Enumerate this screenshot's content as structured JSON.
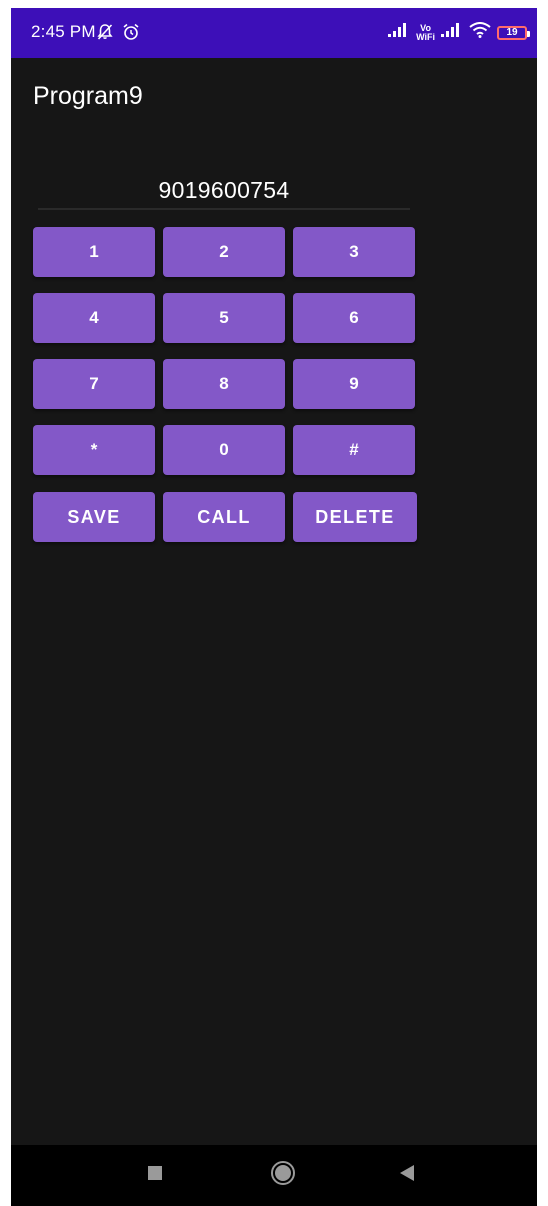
{
  "status_bar": {
    "time": "2:45 PM",
    "volte_top": "Vo",
    "volte_bottom": "WiFi",
    "battery": "19",
    "icons": [
      "bell-off-icon",
      "alarm-icon",
      "signal-icon",
      "signal-icon",
      "wifi-icon",
      "battery-icon"
    ]
  },
  "app": {
    "title": "Program9"
  },
  "dialer": {
    "number": "9019600754",
    "keys": {
      "k1": "1",
      "k2": "2",
      "k3": "3",
      "k4": "4",
      "k5": "5",
      "k6": "6",
      "k7": "7",
      "k8": "8",
      "k9": "9",
      "star": "*",
      "k0": "0",
      "hash": "#"
    },
    "actions": {
      "save": "SAVE",
      "call": "CALL",
      "delete": "DELETE"
    }
  },
  "navigation": {
    "icons": [
      "recents-square-icon",
      "home-circle-icon",
      "back-triangle-icon"
    ]
  },
  "colors": {
    "status_bar": "#3d0fb8",
    "background": "#161616",
    "button": "#8358c8",
    "text": "#ffffff"
  }
}
